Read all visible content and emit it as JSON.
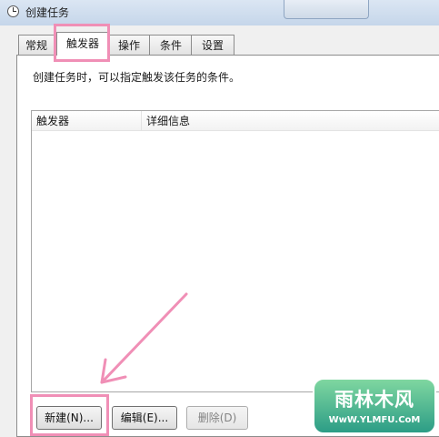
{
  "window": {
    "title": "创建任务"
  },
  "tabs": [
    {
      "label": "常规",
      "active": false
    },
    {
      "label": "触发器",
      "active": true
    },
    {
      "label": "操作",
      "active": false
    },
    {
      "label": "条件",
      "active": false
    },
    {
      "label": "设置",
      "active": false
    }
  ],
  "panel": {
    "description": "创建任务时，可以指定触发该任务的条件。"
  },
  "table": {
    "columns": [
      "触发器",
      "详细信息"
    ],
    "rows": []
  },
  "buttons": {
    "new_label": "新建(N)...",
    "edit_label": "编辑(E)...",
    "delete_label": "删除(D)"
  },
  "watermark": {
    "main": "雨林木风",
    "sub": "WwW.YLMFU.CoM"
  },
  "colors": {
    "highlight": "#f08fb6",
    "titlebar": "#c5d6ea",
    "watermark": "#2c9d86"
  }
}
